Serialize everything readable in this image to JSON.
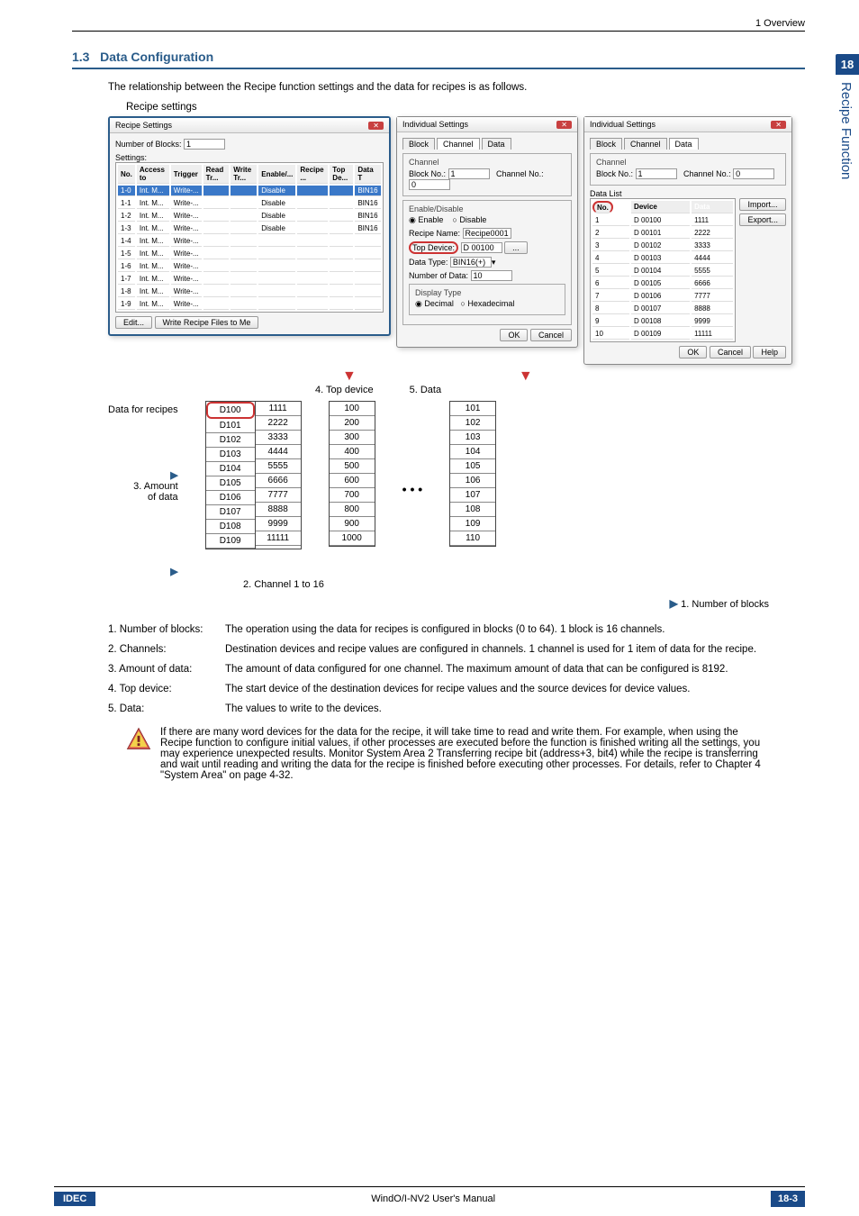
{
  "header": {
    "overview": "1 Overview"
  },
  "sideTab": {
    "num": "18",
    "label": "Recipe Function"
  },
  "section": {
    "num": "1.3",
    "title": "Data Configuration",
    "intro": "The relationship between the Recipe function settings and the data for recipes is as follows.",
    "recipeSettingsLabel": "Recipe settings"
  },
  "dlgMain": {
    "title": "Recipe Settings",
    "numBlocksLabel": "Number of Blocks:",
    "numBlocksVal": "1",
    "settingsLabel": "Settings:",
    "cols": [
      "No.",
      "Access to",
      "Trigger",
      "Read Tr...",
      "Write Tr...",
      "Enable/...",
      "Recipe ...",
      "Top De...",
      "Data T"
    ],
    "rows": [
      {
        "no": "1-0",
        "a": "Int. M...",
        "b": "Write-...",
        "c": "",
        "d": "",
        "e": "Disable",
        "f": "",
        "g": "",
        "h": "BIN16",
        "hl": true
      },
      {
        "no": "1-1",
        "a": "Int. M...",
        "b": "Write-...",
        "c": "",
        "d": "",
        "e": "Disable",
        "f": "",
        "g": "",
        "h": "BIN16"
      },
      {
        "no": "1-2",
        "a": "Int. M...",
        "b": "Write-...",
        "c": "",
        "d": "",
        "e": "Disable",
        "f": "",
        "g": "",
        "h": "BIN16"
      },
      {
        "no": "1-3",
        "a": "Int. M...",
        "b": "Write-...",
        "c": "",
        "d": "",
        "e": "Disable",
        "f": "",
        "g": "",
        "h": "BIN16"
      },
      {
        "no": "1-4",
        "a": "Int. M...",
        "b": "Write-...",
        "c": "",
        "d": "",
        "e": "",
        "f": "",
        "g": "",
        "h": ""
      },
      {
        "no": "1-5",
        "a": "Int. M...",
        "b": "Write-...",
        "c": "",
        "d": "",
        "e": "",
        "f": "",
        "g": "",
        "h": ""
      },
      {
        "no": "1-6",
        "a": "Int. M...",
        "b": "Write-...",
        "c": "",
        "d": "",
        "e": "",
        "f": "",
        "g": "",
        "h": ""
      },
      {
        "no": "1-7",
        "a": "Int. M...",
        "b": "Write-...",
        "c": "",
        "d": "",
        "e": "",
        "f": "",
        "g": "",
        "h": ""
      },
      {
        "no": "1-8",
        "a": "Int. M...",
        "b": "Write-...",
        "c": "",
        "d": "",
        "e": "",
        "f": "",
        "g": "",
        "h": ""
      },
      {
        "no": "1-9",
        "a": "Int. M...",
        "b": "Write-...",
        "c": "",
        "d": "",
        "e": "",
        "f": "",
        "g": "",
        "h": ""
      }
    ],
    "editBtn": "Edit...",
    "writeBtn": "Write Recipe Files to Me"
  },
  "dlgChannel": {
    "title": "Individual Settings",
    "tabs": [
      "Block",
      "Channel",
      "Data"
    ],
    "activeTab": "Channel",
    "channelGroup": "Channel",
    "blockNoLabel": "Block No.:",
    "blockNoVal": "1",
    "channelNoLabel": "Channel No.:",
    "channelNoVal": "0",
    "enableGroup": "Enable/Disable",
    "enableOpt": "Enable",
    "disableOpt": "Disable",
    "recipeNameLabel": "Recipe Name:",
    "recipeNameVal": "Recipe0001",
    "topDeviceLabel": "Top Device:",
    "topDeviceVal": "D 00100",
    "dataTypeLabel": "Data Type:",
    "dataTypeVal": "BIN16(+)",
    "numDataLabel": "Number of Data:",
    "numDataVal": "10",
    "displayGroup": "Display Type",
    "decimalOpt": "Decimal",
    "hexOpt": "Hexadecimal",
    "ok": "OK",
    "cancel": "Cancel"
  },
  "dlgData": {
    "title": "Individual Settings",
    "tabs": [
      "Block",
      "Channel",
      "Data"
    ],
    "activeTab": "Data",
    "channelGroup": "Channel",
    "blockNoLabel": "Block No.:",
    "blockNoVal": "1",
    "channelNoLabel": "Channel No.:",
    "channelNoVal": "0",
    "dataListLabel": "Data List",
    "cols": [
      "No.",
      "Device",
      "Data"
    ],
    "rows": [
      {
        "n": "1",
        "d": "D 00100",
        "v": "1111"
      },
      {
        "n": "2",
        "d": "D 00101",
        "v": "2222"
      },
      {
        "n": "3",
        "d": "D 00102",
        "v": "3333"
      },
      {
        "n": "4",
        "d": "D 00103",
        "v": "4444"
      },
      {
        "n": "5",
        "d": "D 00104",
        "v": "5555"
      },
      {
        "n": "6",
        "d": "D 00105",
        "v": "6666"
      },
      {
        "n": "7",
        "d": "D 00106",
        "v": "7777"
      },
      {
        "n": "8",
        "d": "D 00107",
        "v": "8888"
      },
      {
        "n": "9",
        "d": "D 00108",
        "v": "9999"
      },
      {
        "n": "10",
        "d": "D 00109",
        "v": "11111"
      }
    ],
    "importBtn": "Import...",
    "exportBtn": "Export...",
    "ok": "OK",
    "cancel": "Cancel",
    "help": "Help"
  },
  "diagram": {
    "topDeviceLabel": "4. Top device",
    "dataLabel": "5. Data",
    "dataForRecipes": "Data for recipes",
    "amountLabel": "3. Amount\nof data",
    "channelLabel": "2. Channel 1 to 16",
    "blocksLabel": "1. Number of blocks",
    "col1dev": [
      "D100",
      "D101",
      "D102",
      "D103",
      "D104",
      "D105",
      "D106",
      "D107",
      "D108",
      "D109"
    ],
    "col1val": [
      "1111",
      "2222",
      "3333",
      "4444",
      "5555",
      "6666",
      "7777",
      "8888",
      "9999",
      "11111"
    ],
    "col2val": [
      "100",
      "200",
      "300",
      "400",
      "500",
      "600",
      "700",
      "800",
      "900",
      "1000"
    ],
    "col3val": [
      "101",
      "102",
      "103",
      "104",
      "105",
      "106",
      "107",
      "108",
      "109",
      "110"
    ],
    "ellipsis": "• • •"
  },
  "definitions": [
    {
      "term": "1. Number of blocks:",
      "desc": "The operation using the data for recipes is configured in blocks (0 to 64). 1 block is 16 channels."
    },
    {
      "term": "2. Channels:",
      "desc": "Destination devices and recipe values are configured in channels. 1 channel is used for 1 item of data for the recipe."
    },
    {
      "term": "3. Amount of data:",
      "desc": "The amount of data configured for one channel. The maximum amount of data that can be configured is 8192."
    },
    {
      "term": "4. Top device:",
      "desc": "The start device of the destination devices for recipe values and the source devices for device values."
    },
    {
      "term": "5. Data:",
      "desc": "The values to write to the devices."
    }
  ],
  "note": {
    "text": "If there are many word devices for the data for the recipe, it will take time to read and write them. For example, when using the Recipe function to configure initial values, if other processes are executed before the function is finished writing all the settings, you may experience unexpected results. Monitor System Area 2 Transferring recipe bit (address+3, bit4) while the recipe is transferring and wait until reading and writing the data for the recipe is finished before executing other processes. For details, refer to Chapter 4 \"System Area\" on page 4-32."
  },
  "footer": {
    "logo": "IDEC",
    "center": "WindO/I-NV2 User's Manual",
    "page": "18-3"
  }
}
